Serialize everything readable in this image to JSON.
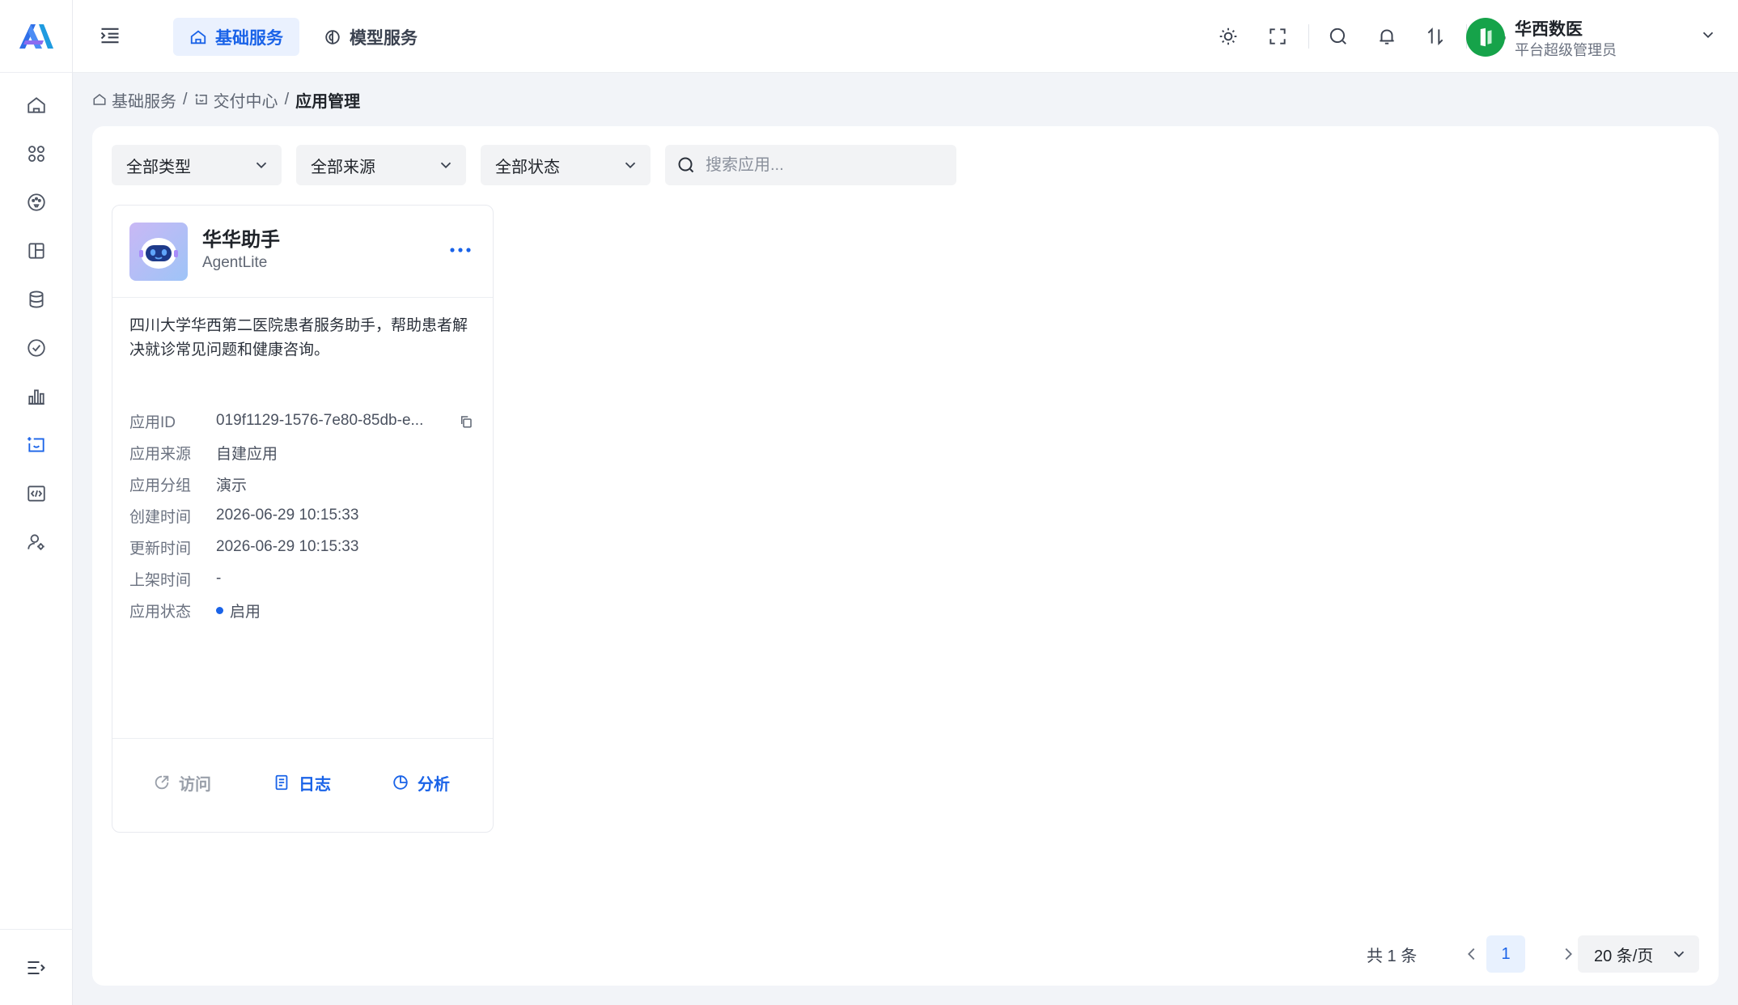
{
  "nav": {
    "tabs": [
      {
        "label": "基础服务",
        "active": true,
        "icon": "home-icon"
      },
      {
        "label": "模型服务",
        "active": false,
        "icon": "model-icon"
      }
    ]
  },
  "sidebar": {
    "items": [
      {
        "name": "home",
        "icon": "home-icon"
      },
      {
        "name": "apps",
        "icon": "grid-icon"
      },
      {
        "name": "palette",
        "icon": "palette-icon"
      },
      {
        "name": "layout",
        "icon": "layout-icon"
      },
      {
        "name": "database",
        "icon": "database-icon"
      },
      {
        "name": "check",
        "icon": "check-circle-icon"
      },
      {
        "name": "stats",
        "icon": "bar-chart-icon"
      },
      {
        "name": "delivery",
        "icon": "delivery-icon",
        "active": true
      },
      {
        "name": "code",
        "icon": "code-icon"
      },
      {
        "name": "user-settings",
        "icon": "user-gear-icon"
      }
    ]
  },
  "topbar": {
    "icons": [
      "sun-icon",
      "fullscreen-icon",
      "search-icon",
      "bell-icon",
      "sort-icon",
      "robot-icon"
    ]
  },
  "user": {
    "name": "华西数医",
    "role": "平台超级管理员"
  },
  "breadcrumb": {
    "items": [
      "基础服务",
      "交付中心",
      "应用管理"
    ],
    "separator": "/"
  },
  "filters": {
    "type": "全部类型",
    "source": "全部来源",
    "status": "全部状态",
    "search_placeholder": "搜索应用..."
  },
  "app_card": {
    "name": "华华助手",
    "type": "AgentLite",
    "description": "四川大学华西第二医院患者服务助手，帮助患者解决就诊常见问题和健康咨询。",
    "fields": [
      {
        "label": "应用ID",
        "value": "019f1129-1576-7e80-85db-e..."
      },
      {
        "label": "应用来源",
        "value": "自建应用"
      },
      {
        "label": "应用分组",
        "value": "演示"
      },
      {
        "label": "创建时间",
        "value": "2026-06-29 10:15:33"
      },
      {
        "label": "更新时间",
        "value": "2026-06-29 10:15:33"
      },
      {
        "label": "上架时间",
        "value": "-"
      },
      {
        "label": "应用状态",
        "value": "启用"
      }
    ],
    "actions": {
      "visit": "访问",
      "log": "日志",
      "analyze": "分析"
    },
    "status_color": "#1a63e8"
  },
  "pagination": {
    "total": "共 1 条",
    "current_page": "1",
    "page_size": "20 条/页"
  },
  "colors": {
    "accent": "#1a63e8",
    "avatar": "#16a34a"
  }
}
